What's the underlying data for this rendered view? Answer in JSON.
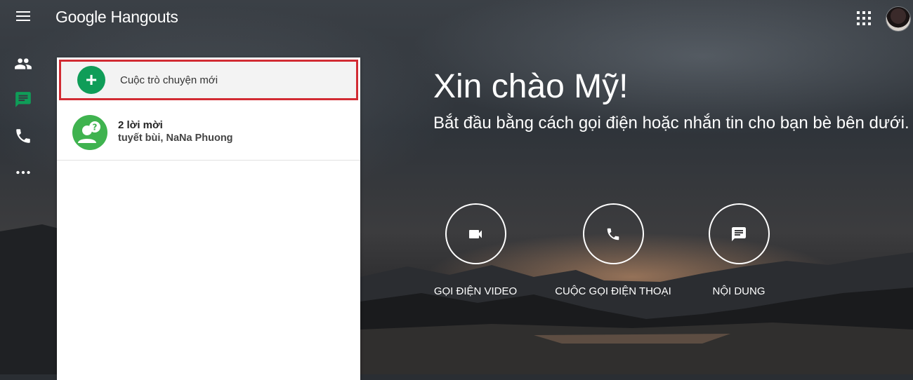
{
  "header": {
    "brand_google": "Google",
    "brand_product": "Hangouts",
    "menu_icon": "hamburger-menu-icon",
    "apps_icon": "apps-grid-icon"
  },
  "rail": {
    "items": [
      {
        "name": "contacts",
        "icon": "people-icon",
        "active": false
      },
      {
        "name": "conversations",
        "icon": "chat-icon",
        "active": true
      },
      {
        "name": "phone-calls",
        "icon": "phone-icon",
        "active": false
      },
      {
        "name": "more",
        "icon": "more-horiz-icon",
        "active": false
      }
    ]
  },
  "panel": {
    "new_chat_label": "Cuộc trò chuyện mới",
    "invite_title": "2 lời mời",
    "invite_names": "tuyết bùi, NaNa Phuong"
  },
  "main": {
    "greeting": "Xin chào Mỹ!",
    "subtitle": "Bắt đầu bằng cách gọi điện hoặc nhắn tin cho bạn bè bên dưới.",
    "actions": [
      {
        "label": "GỌI ĐIỆN VIDEO",
        "icon": "videocam-icon"
      },
      {
        "label": "CUỘC GỌI ĐIỆN THOẠI",
        "icon": "phone-icon"
      },
      {
        "label": "NỘI DUNG",
        "icon": "message-icon"
      }
    ]
  },
  "colors": {
    "accent_green": "#0f9d58",
    "highlight_red": "#d22b33",
    "rail_active": "#0f9d58"
  }
}
